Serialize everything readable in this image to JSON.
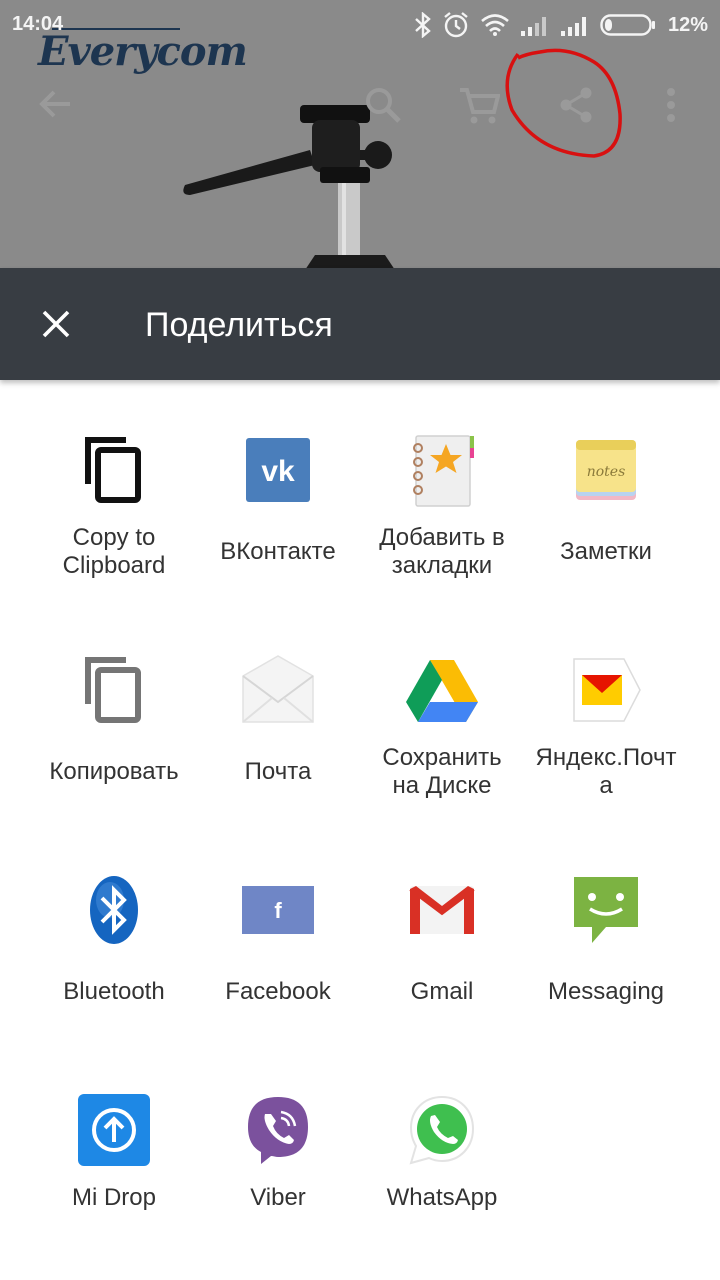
{
  "status_bar": {
    "time": "14:04",
    "battery": "12%"
  },
  "background_app": {
    "logo": "Everycom"
  },
  "share_sheet": {
    "title": "Поделиться",
    "apps": [
      {
        "label": "Copy to\nClipboard",
        "icon": "copy-clipboard-icon"
      },
      {
        "label": "ВКонтакте",
        "icon": "vk-icon"
      },
      {
        "label": "Добавить в\nзакладки",
        "icon": "bookmark-notebook-icon"
      },
      {
        "label": "Заметки",
        "icon": "notes-icon"
      },
      {
        "label": "Копировать",
        "icon": "copy-icon"
      },
      {
        "label": "Почта",
        "icon": "mail-envelope-icon"
      },
      {
        "label": "Сохранить\nна Диске",
        "icon": "google-drive-icon"
      },
      {
        "label": "Яндекс.Почт\nа",
        "icon": "yandex-mail-icon"
      },
      {
        "label": "Bluetooth",
        "icon": "bluetooth-icon"
      },
      {
        "label": "Facebook",
        "icon": "facebook-icon"
      },
      {
        "label": "Gmail",
        "icon": "gmail-icon"
      },
      {
        "label": "Messaging",
        "icon": "messaging-icon"
      },
      {
        "label": "Mi Drop",
        "icon": "mi-drop-icon"
      },
      {
        "label": "Viber",
        "icon": "viber-icon"
      },
      {
        "label": "WhatsApp",
        "icon": "whatsapp-icon"
      }
    ]
  }
}
